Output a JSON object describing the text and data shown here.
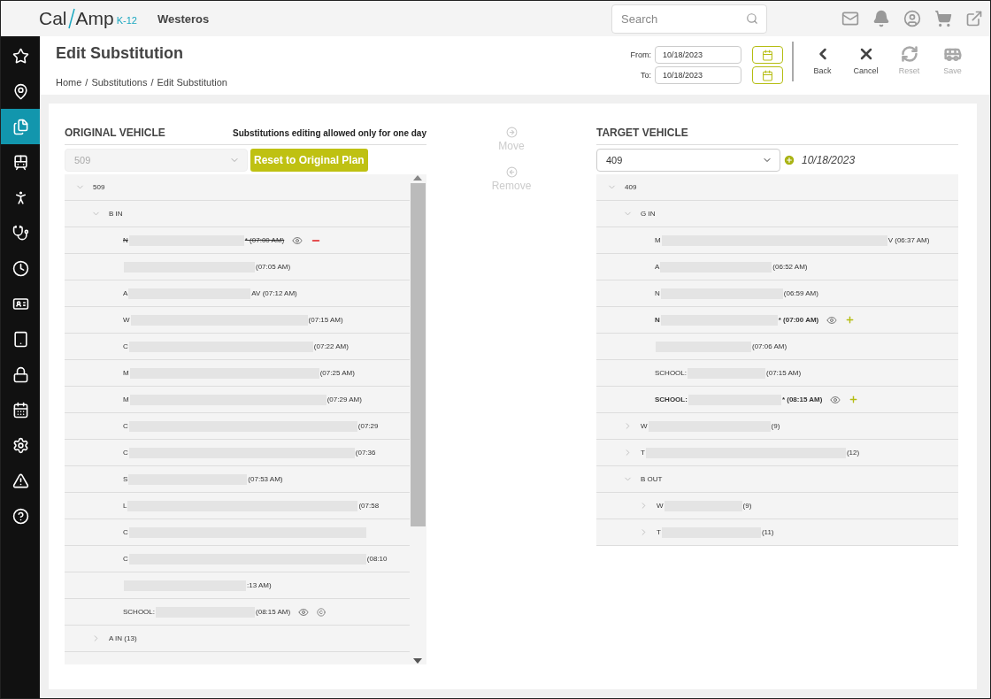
{
  "logo": {
    "first": "Cal",
    "second": "Amp",
    "tag": "K-12"
  },
  "header": {
    "org": "Westeros",
    "search": {
      "placeholder": "Search"
    }
  },
  "sidebar": {
    "items": [
      {
        "selected": false
      },
      {
        "selected": false
      },
      {
        "selected": true
      },
      {
        "selected": false
      },
      {
        "selected": false
      },
      {
        "selected": false
      },
      {
        "selected": false
      },
      {
        "selected": false
      },
      {
        "selected": false
      },
      {
        "selected": false
      },
      {
        "selected": false
      },
      {
        "selected": false
      },
      {
        "selected": false
      },
      {
        "selected": false
      }
    ]
  },
  "page": {
    "title": "Edit Substitution",
    "breadcrumb": [
      "Home",
      "Substitutions",
      "Edit Substitution"
    ],
    "separator": "/"
  },
  "dates": [
    {
      "label": "From:",
      "value": "10/18/2023"
    },
    {
      "label": "To:",
      "value": "10/18/2023"
    }
  ],
  "toolbar": [
    {
      "label": "Back",
      "disabled": false
    },
    {
      "label": "Cancel",
      "disabled": false
    },
    {
      "label": "Reset",
      "disabled": true
    },
    {
      "label": "Save",
      "disabled": true
    }
  ],
  "original": {
    "title": "ORIGINAL VEHICLE",
    "note": "Substitutions editing allowed only for one day",
    "vehicle": "509",
    "vehicle_disabled": true,
    "reset_button": "Reset to Original Plan",
    "tree": [
      {
        "kind": "group",
        "label": "509",
        "expanded": true,
        "children": [
          {
            "kind": "group",
            "label": "B IN",
            "expanded": true,
            "children": [
              {
                "kind": "stop",
                "label": "N",
                "time": "* (07:00 AM)",
                "struck": true,
                "bold": false,
                "actions": [
                  {
                    "kind": "view"
                  },
                  {
                    "kind": "remove"
                  }
                ]
              },
              {
                "kind": "stop",
                "time": "(07:05 AM)",
                "struck": false,
                "bold": false
              },
              {
                "kind": "stop",
                "label": "A",
                "time": "AV (07:12 AM)",
                "struck": false,
                "bold": false
              },
              {
                "kind": "stop",
                "label": "W",
                "time": "(07:15 AM)",
                "struck": false,
                "bold": false
              },
              {
                "kind": "stop",
                "label": "C",
                "time": "(07:22 AM)",
                "struck": false,
                "bold": false
              },
              {
                "kind": "stop",
                "label": "M",
                "time": "(07:25 AM)",
                "struck": false,
                "bold": false
              },
              {
                "kind": "stop",
                "label": "M",
                "time": "(07:29 AM)",
                "struck": false,
                "bold": false
              },
              {
                "kind": "stop",
                "label": "C",
                "time": "(07:29",
                "struck": false,
                "bold": false
              },
              {
                "kind": "stop",
                "label": "C",
                "time": "(07:36",
                "struck": false,
                "bold": false
              },
              {
                "kind": "stop",
                "label": "S",
                "time": "(07:53 AM)",
                "struck": false,
                "bold": false
              },
              {
                "kind": "stop",
                "label": "L",
                "time": "(07:58",
                "struck": false,
                "bold": false
              },
              {
                "kind": "stop",
                "label": "C",
                "struck": false,
                "bold": false
              },
              {
                "kind": "stop",
                "label": "C",
                "time": "(08:10",
                "struck": false,
                "bold": false
              },
              {
                "kind": "stop",
                "time": ":13 AM)",
                "struck": false,
                "bold": false
              },
              {
                "kind": "stop",
                "label": "SCHOOL:",
                "time": "(08:15 AM)",
                "struck": false,
                "bold": false,
                "actions": [
                  {
                    "kind": "view"
                  },
                  {
                    "kind": "copy"
                  }
                ]
              }
            ]
          },
          {
            "kind": "group",
            "label": "A IN (13)",
            "expanded": false
          }
        ]
      }
    ]
  },
  "transfer": [
    {
      "label": "Move",
      "disabled": true
    },
    {
      "label": "Remove",
      "disabled": true
    }
  ],
  "target": {
    "title": "TARGET VEHICLE",
    "vehicle": "409",
    "vehicle_disabled": false,
    "date": "10/18/2023",
    "tree": [
      {
        "kind": "group",
        "label": "409",
        "expanded": true,
        "children": [
          {
            "kind": "group",
            "label": "G IN",
            "expanded": true,
            "children": [
              {
                "kind": "stop",
                "label": "M",
                "time": "V (06:37 AM)",
                "struck": false,
                "bold": false
              },
              {
                "kind": "stop",
                "label": "A",
                "time": "(06:52 AM)",
                "struck": false,
                "bold": false
              },
              {
                "kind": "stop",
                "label": "N",
                "time": "(06:59 AM)",
                "struck": false,
                "bold": false
              },
              {
                "kind": "stop",
                "label": "N",
                "time": "* (07:00 AM)",
                "struck": false,
                "bold": true,
                "actions": [
                  {
                    "kind": "view"
                  },
                  {
                    "kind": "add"
                  }
                ]
              },
              {
                "kind": "stop",
                "time": "(07:06 AM)",
                "struck": false,
                "bold": false
              },
              {
                "kind": "stop",
                "label": "SCHOOL:",
                "time": "(07:15 AM)",
                "struck": false,
                "bold": false
              },
              {
                "kind": "stop",
                "label": "SCHOOL:",
                "time": "* (08:15 AM)",
                "struck": false,
                "bold": true,
                "actions": [
                  {
                    "kind": "view"
                  },
                  {
                    "kind": "add"
                  }
                ]
              }
            ]
          },
          {
            "kind": "group",
            "label": "W",
            "count": "(9)",
            "redacted": true,
            "expanded": false
          },
          {
            "kind": "group",
            "label": "T",
            "count": "(12)",
            "redacted": true,
            "expanded": false
          },
          {
            "kind": "group",
            "label": "B OUT",
            "expanded": true,
            "children": [
              {
                "kind": "group",
                "label": "W",
                "count": "(9)",
                "redacted": true,
                "expanded": false
              },
              {
                "kind": "group",
                "label": "T",
                "count": "(11)",
                "redacted": true,
                "expanded": false
              }
            ]
          }
        ]
      }
    ]
  }
}
